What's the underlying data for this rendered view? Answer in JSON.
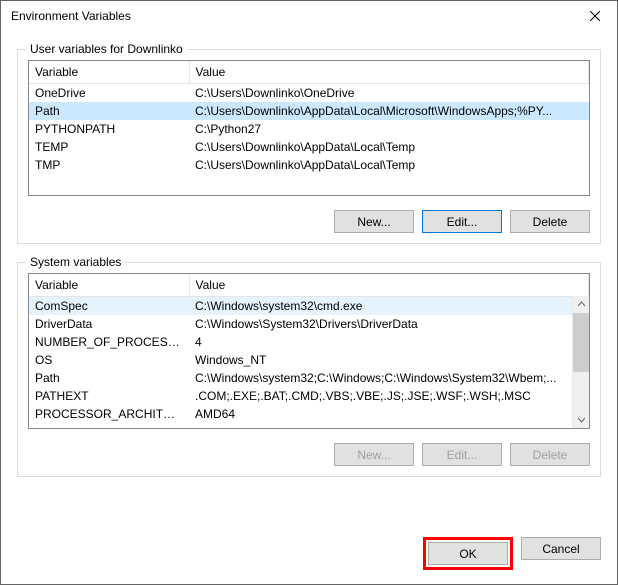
{
  "window": {
    "title": "Environment Variables"
  },
  "user_section": {
    "legend": "User variables for Downlinko",
    "headers": {
      "variable": "Variable",
      "value": "Value"
    },
    "rows": [
      {
        "variable": "OneDrive",
        "value": "C:\\Users\\Downlinko\\OneDrive"
      },
      {
        "variable": "Path",
        "value": "C:\\Users\\Downlinko\\AppData\\Local\\Microsoft\\WindowsApps;%PY..."
      },
      {
        "variable": "PYTHONPATH",
        "value": "C:\\Python27"
      },
      {
        "variable": "TEMP",
        "value": "C:\\Users\\Downlinko\\AppData\\Local\\Temp"
      },
      {
        "variable": "TMP",
        "value": "C:\\Users\\Downlinko\\AppData\\Local\\Temp"
      }
    ],
    "selected_index": 1,
    "buttons": {
      "new": "New...",
      "edit": "Edit...",
      "delete": "Delete"
    }
  },
  "system_section": {
    "legend": "System variables",
    "headers": {
      "variable": "Variable",
      "value": "Value"
    },
    "rows": [
      {
        "variable": "ComSpec",
        "value": "C:\\Windows\\system32\\cmd.exe"
      },
      {
        "variable": "DriverData",
        "value": "C:\\Windows\\System32\\Drivers\\DriverData"
      },
      {
        "variable": "NUMBER_OF_PROCESSORS",
        "value": "4"
      },
      {
        "variable": "OS",
        "value": "Windows_NT"
      },
      {
        "variable": "Path",
        "value": "C:\\Windows\\system32;C:\\Windows;C:\\Windows\\System32\\Wbem;..."
      },
      {
        "variable": "PATHEXT",
        "value": ".COM;.EXE;.BAT;.CMD;.VBS;.VBE;.JS;.JSE;.WSF;.WSH;.MSC"
      },
      {
        "variable": "PROCESSOR_ARCHITECTURE",
        "value": "AMD64"
      }
    ],
    "selected_index": 0,
    "buttons": {
      "new": "New...",
      "edit": "Edit...",
      "delete": "Delete"
    }
  },
  "dialog_buttons": {
    "ok": "OK",
    "cancel": "Cancel"
  }
}
